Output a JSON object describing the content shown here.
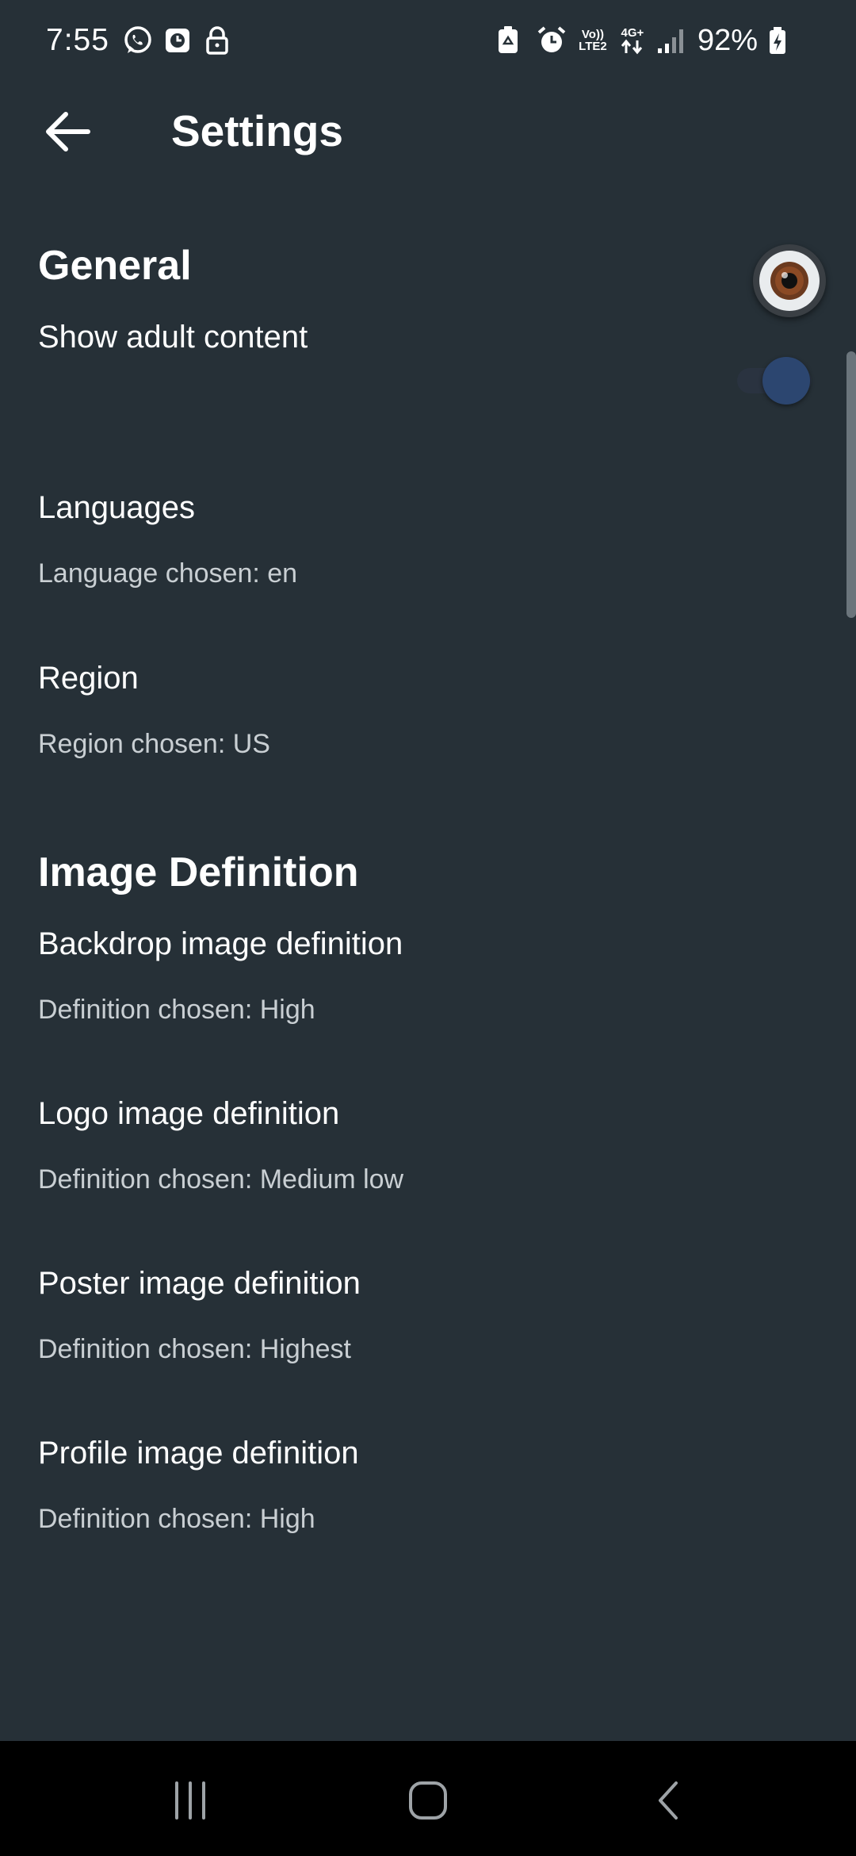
{
  "status_bar": {
    "time": "7:55",
    "battery_percent": "92%",
    "volte_label_top": "Vo))",
    "volte_label_bottom": "LTE2",
    "network_label": "4G+",
    "left_icons": [
      "whatsapp-icon",
      "clock-app-icon",
      "lock-icon"
    ],
    "right_icons": [
      "recycle-icon",
      "alarm-icon",
      "volte-icon",
      "data-arrows-icon",
      "signal-icon",
      "battery-charging-icon"
    ]
  },
  "app_bar": {
    "title": "Settings",
    "back_icon": "arrow-left-icon"
  },
  "general": {
    "header": "General",
    "adult_content": {
      "title": "Show adult content",
      "enabled": false
    },
    "languages": {
      "title": "Languages",
      "summary": "Language chosen: en"
    },
    "region": {
      "title": "Region",
      "summary": "Region chosen: US"
    }
  },
  "image_definition": {
    "header": "Image Definition",
    "backdrop": {
      "title": "Backdrop image definition",
      "summary": "Definition chosen: High"
    },
    "logo": {
      "title": "Logo image definition",
      "summary": "Definition chosen: Medium low"
    },
    "poster": {
      "title": "Poster image definition",
      "summary": "Definition chosen: Highest"
    },
    "profile": {
      "title": "Profile image definition",
      "summary": "Definition chosen: High"
    }
  },
  "nav_bar": {
    "recents_icon": "recents-icon",
    "home_icon": "home-icon",
    "back_icon": "nav-back-icon"
  },
  "colors": {
    "background": "#263037",
    "summary_text": "#c9cfd3",
    "toggle_thumb": "#2c4670",
    "nav_background": "#000000"
  }
}
